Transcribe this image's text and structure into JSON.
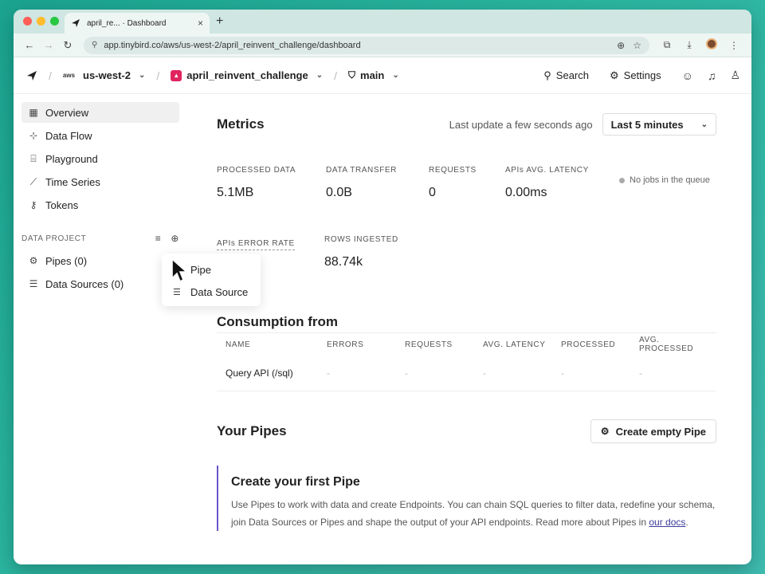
{
  "browser": {
    "tab_title": "april_re... · Dashboard",
    "tab_close": "×",
    "new_tab": "+",
    "url": "app.tinybird.co/aws/us-west-2/april_reinvent_challenge/dashboard",
    "site_info": "⚲"
  },
  "header": {
    "region_provider": "aws",
    "region": "us-west-2",
    "workspace": "april_reinvent_challenge",
    "branch": "main",
    "search_label": "Search",
    "settings_label": "Settings"
  },
  "sidebar": {
    "items": [
      {
        "label": "Overview",
        "icon": "grid-icon",
        "glyph": "▦"
      },
      {
        "label": "Data Flow",
        "icon": "data-flow-icon",
        "glyph": "⊹"
      },
      {
        "label": "Playground",
        "icon": "playground-icon",
        "glyph": "⌸"
      },
      {
        "label": "Time Series",
        "icon": "time-series-icon",
        "glyph": "⟋"
      },
      {
        "label": "Tokens",
        "icon": "key-icon",
        "glyph": "⚷"
      }
    ],
    "section_title": "DATA PROJECT",
    "project_items": [
      {
        "label": "Pipes (0)",
        "icon": "pipe-icon",
        "glyph": "⚙"
      },
      {
        "label": "Data Sources (0)",
        "icon": "database-icon",
        "glyph": "☰"
      }
    ]
  },
  "popup": {
    "items": [
      {
        "label": "Pipe",
        "icon": "pipe-icon",
        "glyph": "⚙"
      },
      {
        "label": "Data Source",
        "icon": "database-icon",
        "glyph": "☰"
      }
    ]
  },
  "metrics": {
    "title": "Metrics",
    "last_update": "Last update a few seconds ago",
    "range": "Last 5 minutes",
    "queue_status": "No jobs in the queue",
    "processed_data": {
      "label": "PROCESSED DATA",
      "value": "5.1MB"
    },
    "data_transfer": {
      "label": "DATA TRANSFER",
      "value": "0.0B"
    },
    "requests": {
      "label": "REQUESTS",
      "value": "0"
    },
    "latency": {
      "label": "APIs AVG. LATENCY",
      "value": "0.00ms"
    },
    "error_rate": {
      "label": "APIs ERROR RATE",
      "value": ""
    },
    "rows_ingested": {
      "label": "ROWS INGESTED",
      "value": "88.74k"
    }
  },
  "consumption": {
    "title": "Consumption from",
    "columns": [
      "NAME",
      "ERRORS",
      "REQUESTS",
      "AVG. LATENCY",
      "PROCESSED",
      "AVG. PROCESSED"
    ],
    "rows": [
      [
        "Query API (/sql)",
        "-",
        "-",
        "-",
        "-",
        "-"
      ]
    ]
  },
  "pipes": {
    "title": "Your Pipes",
    "create_button": "Create empty Pipe",
    "cta_title": "Create your first Pipe",
    "cta_text": "Use Pipes to work with data and create Endpoints. You can chain SQL queries to filter data, redefine your schema, join Data Sources or Pipes and shape the output of your API endpoints. Read more about Pipes in ",
    "cta_link": "our docs",
    "cta_end": "."
  },
  "colors": {
    "accent": "#6a54c9",
    "workspace_badge": "#e0245e",
    "background": "#2bb5a0"
  }
}
